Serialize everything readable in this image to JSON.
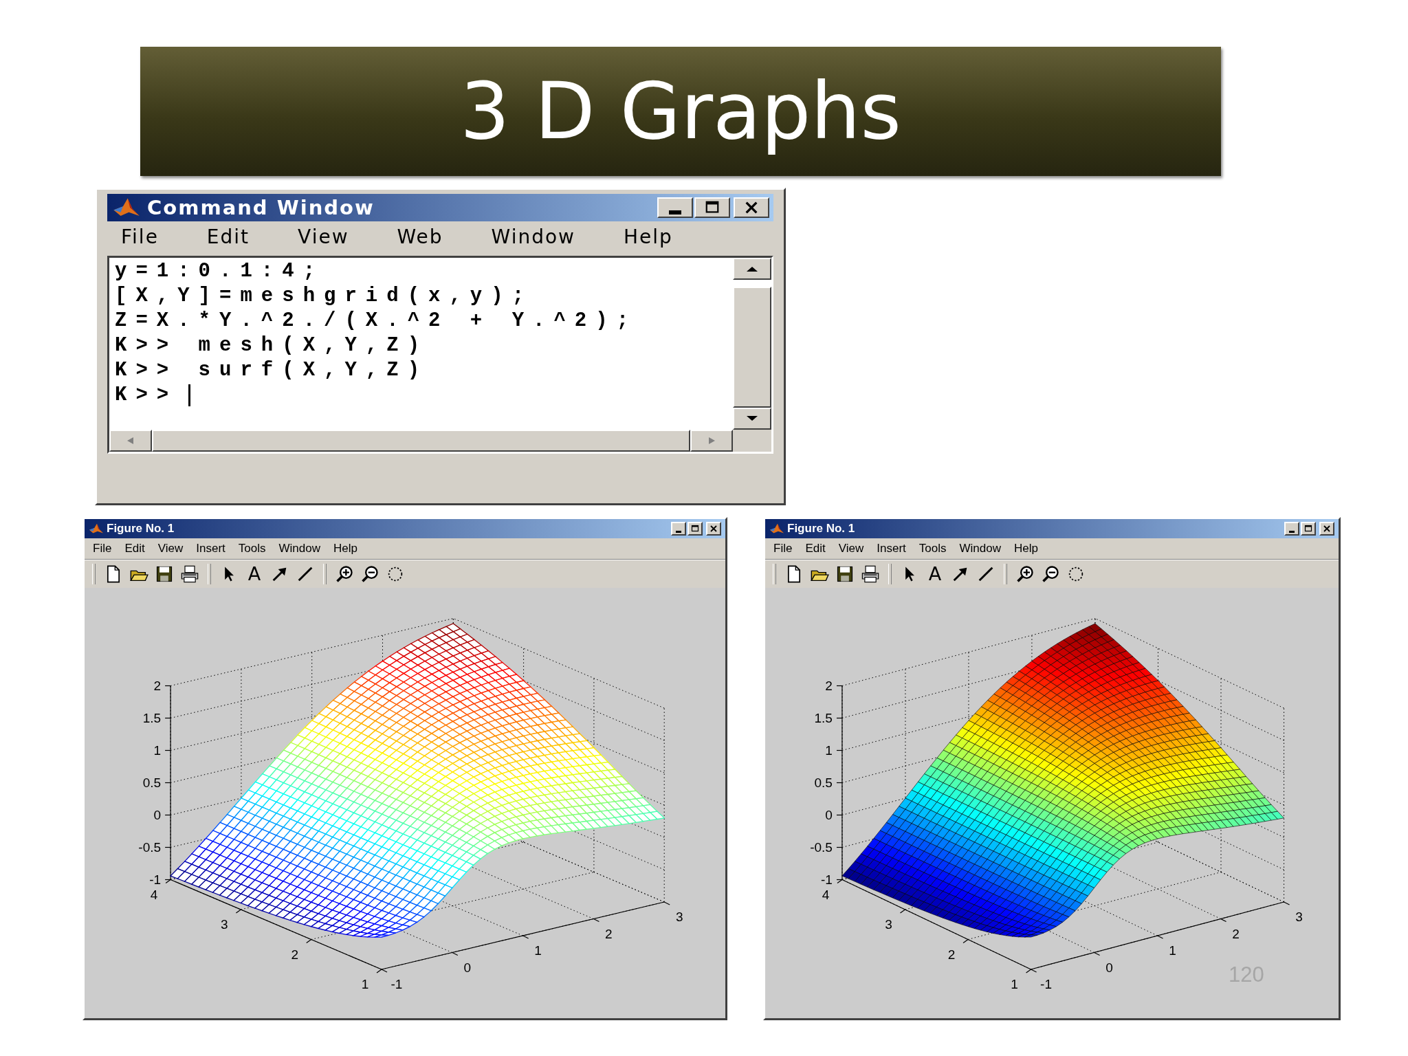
{
  "slide": {
    "title": "3 D Graphs",
    "page_number": "120"
  },
  "command_window": {
    "title": "Command Window",
    "menu": [
      "File",
      "Edit",
      "View",
      "Web",
      "Window",
      "Help"
    ],
    "lines": [
      "y=1:0.1:4;",
      "[X,Y]=meshgrid(x,y);",
      "Z=X.*Y.^2./(X.^2 + Y.^2);",
      "K>> mesh(X,Y,Z)",
      "K>> surf(X,Y,Z)",
      "K>>"
    ]
  },
  "figures": [
    {
      "title": "Figure No. 1",
      "menu": [
        "File",
        "Edit",
        "View",
        "Insert",
        "Tools",
        "Window",
        "Help"
      ],
      "text_tool": "A",
      "plot": {
        "kind": "mesh",
        "z_ticks": [
          "2",
          "1.5",
          "1",
          "0.5",
          "0",
          "-0.5",
          "-1"
        ],
        "y_ticks": [
          "4",
          "3",
          "2",
          "1"
        ],
        "x_ticks": [
          "-1",
          "0",
          "1",
          "2",
          "3"
        ]
      }
    },
    {
      "title": "Figure No. 1",
      "menu": [
        "File",
        "Edit",
        "View",
        "Insert",
        "Tools",
        "Window",
        "Help"
      ],
      "text_tool": "A",
      "plot": {
        "kind": "surf",
        "z_ticks": [
          "2",
          "1.5",
          "1",
          "0.5",
          "0",
          "-0.5",
          "-1"
        ],
        "y_ticks": [
          "4",
          "3",
          "2",
          "1"
        ],
        "x_ticks": [
          "-1",
          "0",
          "1",
          "2",
          "3"
        ]
      }
    }
  ]
}
